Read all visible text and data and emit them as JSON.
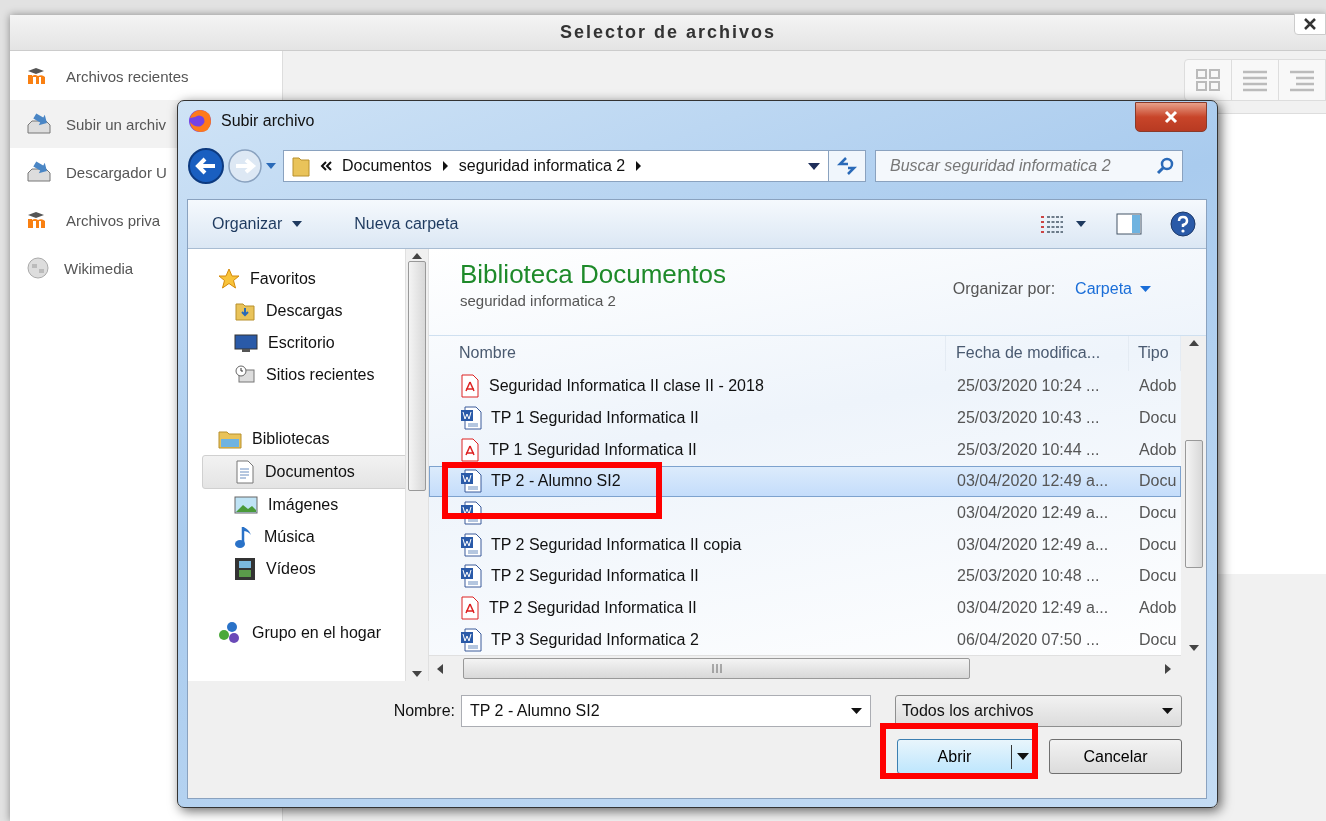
{
  "picker": {
    "title": "Selector de archivos",
    "sidebar": [
      {
        "label": "Archivos recientes",
        "kind": "moodle",
        "selected": false
      },
      {
        "label": "Subir un archiv",
        "kind": "upload",
        "selected": true
      },
      {
        "label": "Descargador U",
        "kind": "upload",
        "selected": false
      },
      {
        "label": "Archivos priva",
        "kind": "moodle",
        "selected": false
      },
      {
        "label": "Wikimedia",
        "kind": "wiki",
        "selected": false
      }
    ]
  },
  "dialog": {
    "title": "Subir archivo",
    "address": {
      "crumbs": [
        "Documentos",
        "seguridad informatica 2"
      ]
    },
    "search": {
      "placeholder": "Buscar seguridad informatica 2"
    },
    "toolbar": [
      "Organizar",
      "Nueva carpeta"
    ],
    "nav": [
      {
        "label": "Favoritos",
        "kind": "star",
        "selected": false,
        "children": [
          {
            "label": "Descargas",
            "kind": "download",
            "selected": false
          },
          {
            "label": "Escritorio",
            "kind": "desktop",
            "selected": false
          },
          {
            "label": "Sitios recientes",
            "kind": "recent",
            "selected": false
          }
        ]
      },
      {
        "label": "Bibliotecas",
        "kind": "library",
        "selected": false,
        "children": [
          {
            "label": "Documentos",
            "kind": "docs",
            "selected": true
          },
          {
            "label": "Imágenes",
            "kind": "pictures",
            "selected": false
          },
          {
            "label": "Música",
            "kind": "music",
            "selected": false
          },
          {
            "label": "Vídeos",
            "kind": "video",
            "selected": false
          }
        ]
      },
      {
        "label": "Grupo en el hogar",
        "kind": "homegroup",
        "selected": false
      }
    ],
    "library": {
      "title": "Biblioteca Documentos",
      "subtitle": "seguridad informatica 2",
      "arrange_label": "Organizar por:",
      "arrange_value": "Carpeta"
    },
    "columns": [
      "Nombre",
      "Fecha de modifica...",
      "Tipo"
    ],
    "rows": [
      {
        "name": "Seguridad Informatica II clase II - 2018",
        "date": "25/03/2020 10:24 ...",
        "type": "Adob",
        "kind": "pdf",
        "selected": false
      },
      {
        "name": "TP 1 Seguridad Informatica II",
        "date": "25/03/2020 10:43 ...",
        "type": "Docu",
        "kind": "word",
        "selected": false
      },
      {
        "name": "TP 1 Seguridad Informatica II",
        "date": "25/03/2020 10:44 ...",
        "type": "Adob",
        "kind": "pdf",
        "selected": false
      },
      {
        "name": "TP 2 - Alumno SI2",
        "date": "03/04/2020 12:49 a...",
        "type": "Docu",
        "kind": "word",
        "selected": true,
        "highlighted": true
      },
      {
        "date": "03/04/2020 12:49 a...",
        "type": "Docu",
        "kind": "word",
        "selected": false
      },
      {
        "name": "TP 2 Seguridad Informatica II copia",
        "date": "03/04/2020 12:49 a...",
        "type": "Docu",
        "kind": "word",
        "selected": false
      },
      {
        "name": "TP 2 Seguridad Informatica II",
        "date": "25/03/2020 10:48 ...",
        "type": "Docu",
        "kind": "word",
        "selected": false
      },
      {
        "name": "TP 2 Seguridad Informatica II",
        "date": "03/04/2020 12:49 a...",
        "type": "Adob",
        "kind": "pdf",
        "selected": false
      },
      {
        "name": "TP 3 Seguridad Informatica 2",
        "date": "06/04/2020 07:50 ...",
        "type": "Docu",
        "kind": "word",
        "selected": false
      }
    ],
    "filename_label": "Nombre:",
    "filename": "TP 2 - Alumno SI2",
    "filter": "Todos los archivos",
    "buttons": [
      "Abrir",
      "Cancelar"
    ],
    "open_highlighted": true
  }
}
